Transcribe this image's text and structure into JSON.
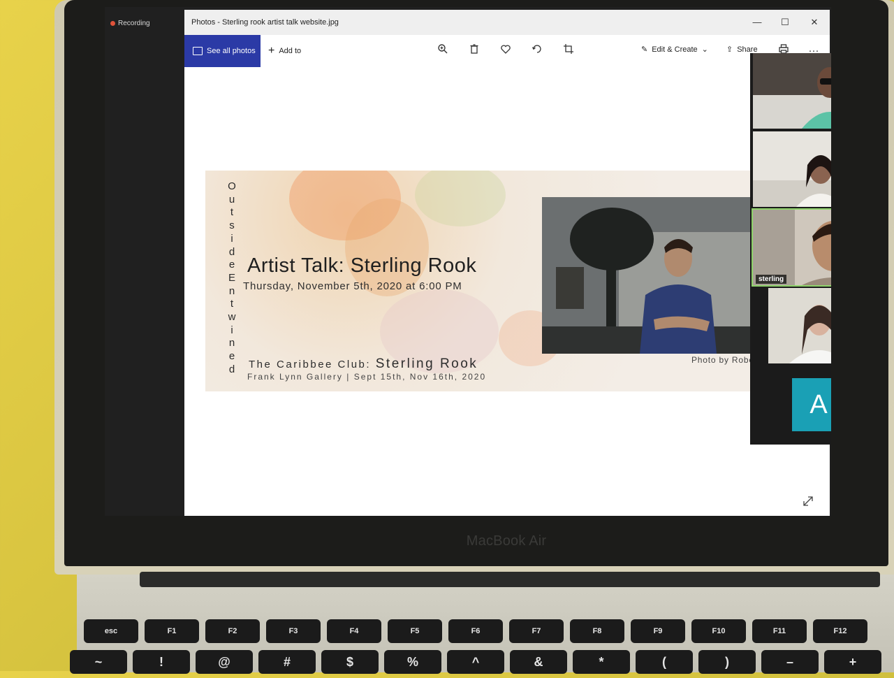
{
  "hardware": {
    "brand": "MacBook Air"
  },
  "recording": {
    "label": "Recording"
  },
  "window": {
    "title": "Photos - Sterling rook artist talk website.jpg",
    "controls": {
      "minimize": "—",
      "maximize": "☐",
      "close": "✕"
    }
  },
  "toolbar": {
    "see_all": "See all photos",
    "add_to": "Add to",
    "edit_create": "Edit & Create",
    "share": "Share",
    "more": "···"
  },
  "poster": {
    "vertical_letters": [
      "O",
      "u",
      "t",
      "s",
      "i",
      "d",
      "e",
      "E",
      "n",
      "t",
      "w",
      "i",
      "n",
      "e",
      "d"
    ],
    "title": "Artist Talk: Sterling Rook",
    "date": "Thursday, November 5th, 2020 at 6:00 PM",
    "club_prefix": "The Caribbee Club:",
    "club_name": "Sterling Rook",
    "gallery": "Frank Lynn Gallery | Sept 15th, Nov 16th, 2020",
    "credit": "Photo by Robe"
  },
  "participants": [
    {
      "name": ""
    },
    {
      "name": ""
    },
    {
      "name": "sterling"
    },
    {
      "name": ""
    },
    {
      "initial": "A"
    }
  ],
  "keyboard": {
    "fn_row": [
      "esc",
      "F1",
      "F2",
      "F3",
      "F4",
      "F5",
      "F6",
      "F7",
      "F8",
      "F9",
      "F10",
      "F11",
      "F12"
    ],
    "num_row": [
      "~",
      "!",
      "@",
      "#",
      "$",
      "%",
      "^",
      "&",
      "*",
      "(",
      ")",
      "–",
      "+"
    ]
  }
}
